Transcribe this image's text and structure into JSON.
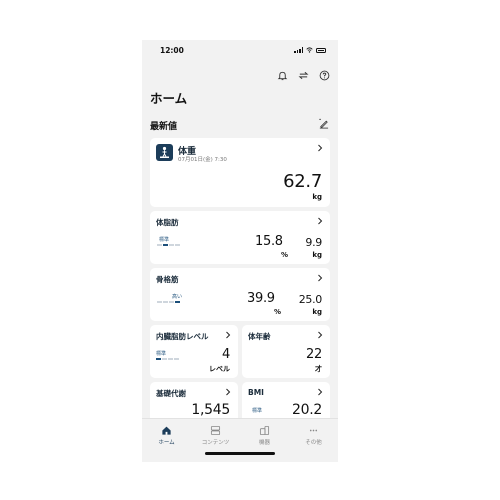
{
  "status_bar": {
    "time": "12:00"
  },
  "header": {
    "title": "ホーム",
    "icons": [
      "bell-icon",
      "sync-icon",
      "help-icon"
    ]
  },
  "section": {
    "title": "最新値",
    "edit_icon": "pencil-icon"
  },
  "weight": {
    "label": "体重",
    "date": "07月01日(金) 7:30",
    "value": "62.7",
    "unit": "kg"
  },
  "body_fat": {
    "label": "体脂肪",
    "level": "標準",
    "level_fill": 0.5,
    "percent": "15.8",
    "percent_unit": "%",
    "mass": "9.9",
    "mass_unit": "kg"
  },
  "skeletal_muscle": {
    "label": "骨格筋",
    "level": "高い",
    "level_fill": 1.0,
    "percent": "39.9",
    "percent_unit": "%",
    "mass": "25.0",
    "mass_unit": "kg"
  },
  "visceral_fat": {
    "label": "内臓脂肪レベル",
    "level": "標準",
    "level_fill": 0.25,
    "value": "4",
    "unit": "レベル"
  },
  "body_age": {
    "label": "体年齢",
    "value": "22",
    "unit": "才"
  },
  "bmr": {
    "label": "基礎代謝",
    "value": "1,545"
  },
  "bmi": {
    "label": "BMI",
    "level": "標準",
    "value": "20.2"
  },
  "tabs": [
    {
      "label": "ホーム",
      "icon": "home-icon",
      "active": true
    },
    {
      "label": "コンテンツ",
      "icon": "contents-icon",
      "active": false
    },
    {
      "label": "機器",
      "icon": "device-icon",
      "active": false
    },
    {
      "label": "その他",
      "icon": "more-icon",
      "active": false
    }
  ],
  "colors": {
    "accent": "#1c4f7a",
    "background": "#f2f2f2",
    "card": "#ffffff"
  }
}
